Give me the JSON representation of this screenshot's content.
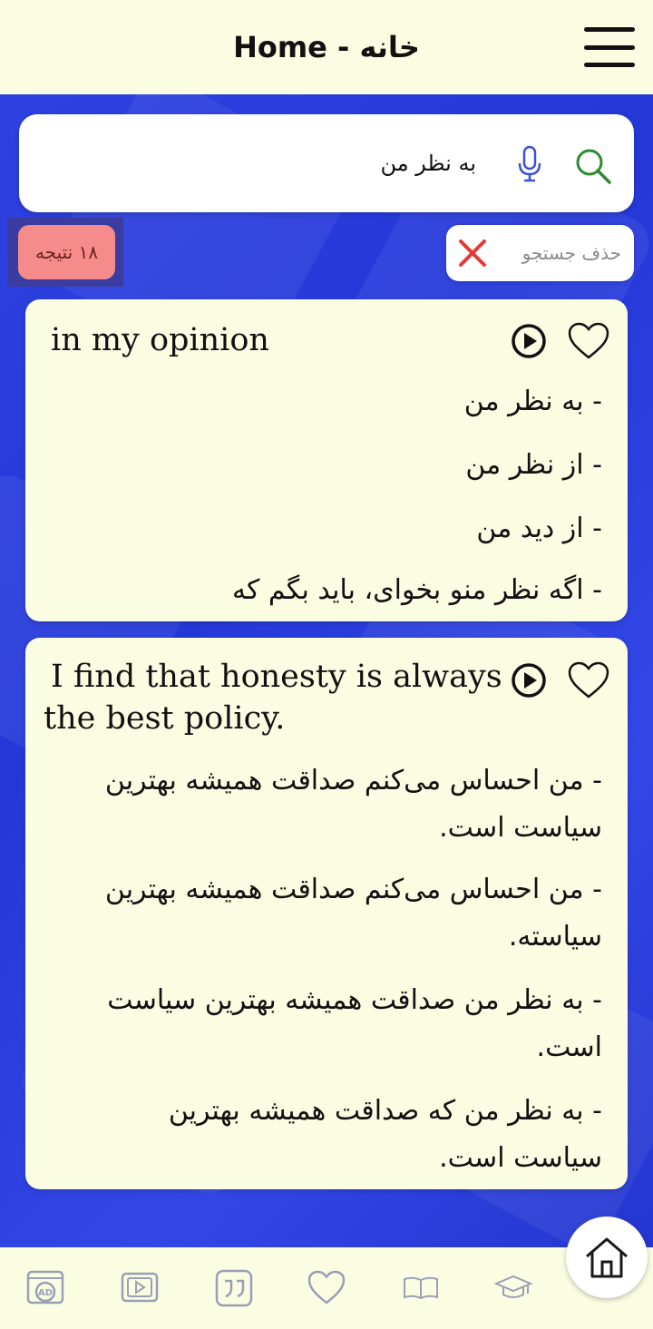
{
  "header": {
    "title": "Home - خانه"
  },
  "search": {
    "query": "به نظر من"
  },
  "clear_search": {
    "label": "حذف جستجو"
  },
  "results": {
    "count_label": "۱۸ نتیجه"
  },
  "cards": [
    {
      "english": "in my opinion",
      "translations": [
        "- به نظر من",
        "- از نظر من",
        "- از دید من",
        "- اگه نظر منو بخوای، باید بگم که"
      ]
    },
    {
      "english_line1": "I find that honesty is always",
      "english_line2": "the best policy.",
      "translations": [
        {
          "line1": "- من احساس می‌کنم صداقت همیشه بهترین",
          "line2": "سیاست است."
        },
        {
          "line1": "- من احساس می‌کنم صداقت همیشه بهترین",
          "line2": "سیاسته."
        },
        {
          "line1": "- به نظر من صداقت همیشه بهترین سیاست",
          "line2": "است."
        },
        {
          "line1": "- به نظر من که صداقت همیشه بهترین",
          "line2": "سیاست است."
        }
      ]
    }
  ],
  "bottom_nav": {
    "items": [
      "ad-icon",
      "video-icon",
      "quote-icon",
      "heart-icon",
      "book-icon",
      "graduation-cap-icon"
    ],
    "home": "home-icon"
  },
  "colors": {
    "background": "#2f42e2",
    "panel": "#fbfde3",
    "badge": "#f58b8b",
    "search_icon": "#2e8b2e",
    "mic_icon": "#3b52d6",
    "clear_icon": "#e53935"
  }
}
